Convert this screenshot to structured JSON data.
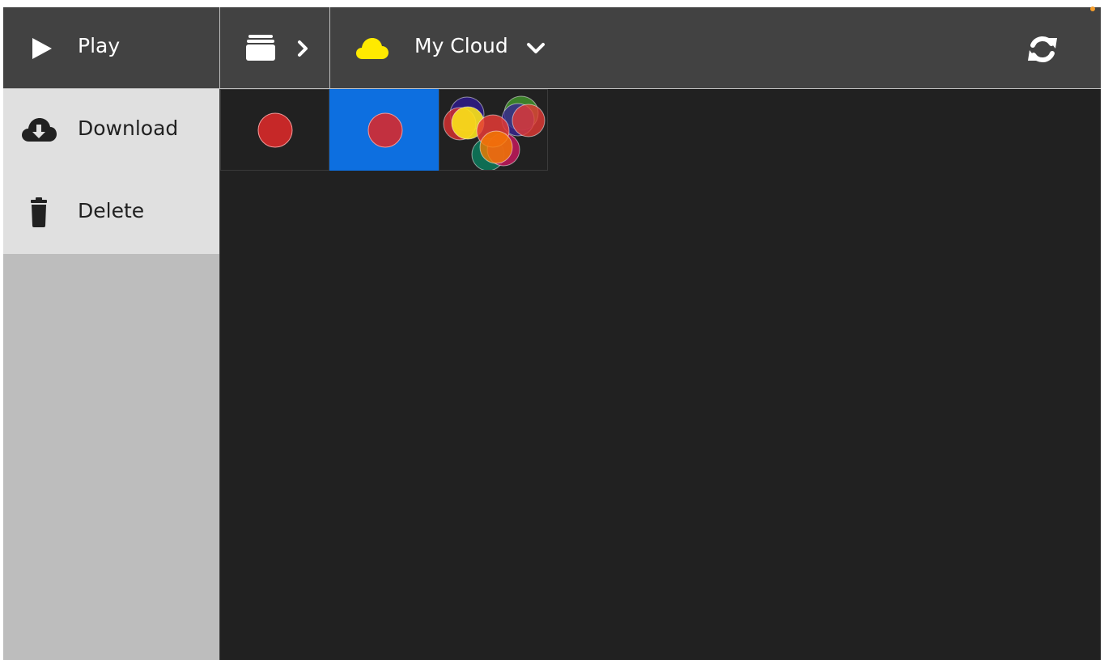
{
  "toolbar": {
    "play_label": "Play",
    "cloud_label": "My Cloud"
  },
  "menu": {
    "items": [
      {
        "label": "Download",
        "icon": "cloud-download-icon"
      },
      {
        "label": "Delete",
        "icon": "trash-icon"
      }
    ]
  },
  "colors": {
    "topbar": "#424242",
    "menu_bg": "#e0e0e0",
    "sidebar_bg": "#bdbdbd",
    "content_bg": "#212121",
    "selected": "#0d6fe0",
    "cloud": "#ffea00",
    "indicator": "#f59d2a"
  },
  "thumbnails": [
    {
      "name": "red-circle",
      "selected": false
    },
    {
      "name": "red-circle-selected",
      "selected": true
    },
    {
      "name": "multi-circles",
      "selected": false
    }
  ]
}
